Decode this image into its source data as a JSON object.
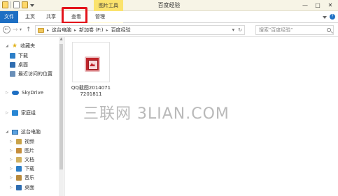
{
  "window": {
    "title": "百度经验",
    "context_tab": "图片工具",
    "buttons": [
      "—",
      "□",
      "✕"
    ]
  },
  "ribbon": {
    "tabs": [
      {
        "label": "文件"
      },
      {
        "label": "主页"
      },
      {
        "label": "共享"
      },
      {
        "label": "查看"
      },
      {
        "label": "管理"
      }
    ]
  },
  "address_bar": {
    "crumbs": [
      "这台电脑",
      "新加卷 (F:)",
      "百度经验"
    ],
    "search_placeholder": "搜索\"百度经验\""
  },
  "nav_pane": {
    "favorites_label": "收藏夹",
    "favorites": [
      "下载",
      "桌面",
      "最近访问的位置"
    ],
    "skydrive": "SkyDrive",
    "homegroup": "家庭组",
    "this_pc": "这台电脑",
    "pc_items": [
      "视频",
      "图片",
      "文档",
      "下载",
      "音乐",
      "桌面"
    ]
  },
  "files": [
    {
      "name": "QQ截图20140717201811",
      "type": "image"
    }
  ],
  "watermark": "三联网 3LIAN.COM",
  "colors": {
    "file_tab": "#1e6fc3",
    "context_tab": "#fbe36d",
    "highlight_box": "#e3141b"
  }
}
